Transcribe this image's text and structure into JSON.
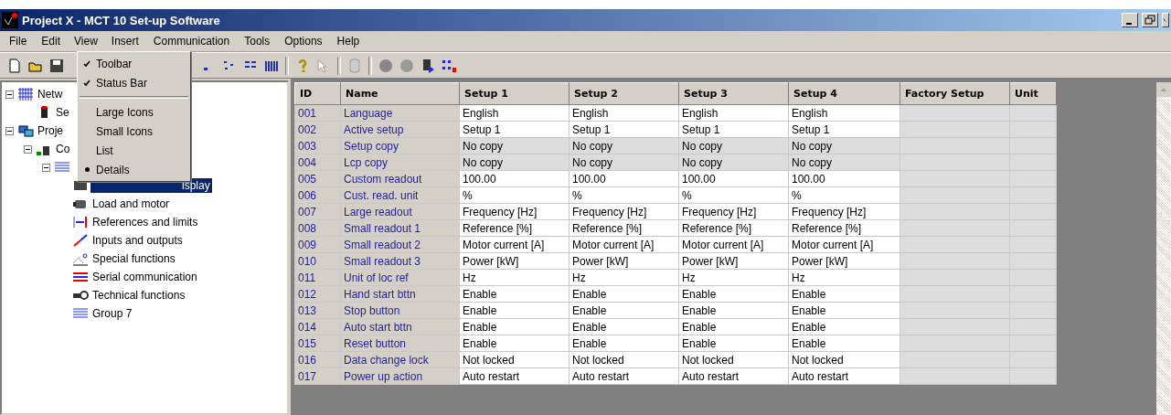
{
  "window": {
    "title": "Project X - MCT 10 Set-up Software"
  },
  "menu_bar": [
    {
      "label": "File",
      "selected": false
    },
    {
      "label": "Edit",
      "selected": false
    },
    {
      "label": "View",
      "selected": true
    },
    {
      "label": "Insert",
      "selected": false
    },
    {
      "label": "Communication",
      "selected": false
    },
    {
      "label": "Tools",
      "selected": false
    },
    {
      "label": "Options",
      "selected": false
    },
    {
      "label": "Help",
      "selected": false
    }
  ],
  "view_menu": [
    {
      "kind": "check",
      "label": "Toolbar",
      "checked": true
    },
    {
      "kind": "check",
      "label": "Status Bar",
      "checked": true
    },
    {
      "kind": "separator"
    },
    {
      "kind": "radio",
      "label": "Large Icons",
      "selected": false
    },
    {
      "kind": "radio",
      "label": "Small Icons",
      "selected": false
    },
    {
      "kind": "radio",
      "label": "List",
      "selected": false
    },
    {
      "kind": "radio",
      "label": "Details",
      "selected": true
    }
  ],
  "tree": [
    {
      "label": "Netw",
      "selected": false,
      "expanded": true,
      "children": [
        {
          "label": "Se",
          "selected": false
        }
      ]
    },
    {
      "label": "Proje",
      "selected": false,
      "expanded": true,
      "children": [
        {
          "label": "Co",
          "selected": false,
          "expanded": true,
          "children": [
            {
              "expanded": true,
              "children": [
                {
                  "label": "isplay",
                  "selected": true
                },
                {
                  "label": "Load and motor",
                  "selected": false
                },
                {
                  "label": "References and limits",
                  "selected": false
                },
                {
                  "label": "Inputs and outputs",
                  "selected": false
                },
                {
                  "label": "Special functions",
                  "selected": false
                },
                {
                  "label": "Serial communication",
                  "selected": false
                },
                {
                  "label": "Technical functions",
                  "selected": false
                },
                {
                  "label": "Group 7",
                  "selected": false
                }
              ]
            }
          ]
        }
      ]
    }
  ],
  "table": {
    "columns": [
      "ID",
      "Name",
      "Setup 1",
      "Setup 2",
      "Setup 3",
      "Setup 4",
      "Factory Setup",
      "Unit"
    ],
    "rows": [
      {
        "id": "001",
        "name": "Language",
        "values": [
          "English",
          "English",
          "English",
          "English"
        ],
        "disabled": false
      },
      {
        "id": "002",
        "name": "Active setup",
        "values": [
          "Setup 1",
          "Setup 1",
          "Setup 1",
          "Setup 1"
        ],
        "disabled": false
      },
      {
        "id": "003",
        "name": "Setup copy",
        "values": [
          "No copy",
          "No copy",
          "No copy",
          "No copy"
        ],
        "disabled": true
      },
      {
        "id": "004",
        "name": "Lcp copy",
        "values": [
          "No copy",
          "No copy",
          "No copy",
          "No copy"
        ],
        "disabled": true
      },
      {
        "id": "005",
        "name": "Custom readout",
        "values": [
          "100.00",
          "100.00",
          "100.00",
          "100.00"
        ],
        "disabled": false
      },
      {
        "id": "006",
        "name": "Cust. read. unit",
        "values": [
          "%",
          "%",
          "%",
          "%"
        ],
        "disabled": false
      },
      {
        "id": "007",
        "name": "Large readout",
        "values": [
          "Frequency [Hz]",
          "Frequency [Hz]",
          "Frequency [Hz]",
          "Frequency [Hz]"
        ],
        "disabled": false
      },
      {
        "id": "008",
        "name": "Small readout 1",
        "values": [
          "Reference [%]",
          "Reference [%]",
          "Reference [%]",
          "Reference [%]"
        ],
        "disabled": false
      },
      {
        "id": "009",
        "name": "Small readout 2",
        "values": [
          "Motor current [A]",
          "Motor current [A]",
          "Motor current [A]",
          "Motor current [A]"
        ],
        "disabled": false
      },
      {
        "id": "010",
        "name": "Small readout 3",
        "values": [
          "Power [kW]",
          "Power [kW]",
          "Power [kW]",
          "Power [kW]"
        ],
        "disabled": false
      },
      {
        "id": "011",
        "name": "Unit of loc ref",
        "values": [
          "Hz",
          "Hz",
          "Hz",
          "Hz"
        ],
        "disabled": false
      },
      {
        "id": "012",
        "name": "Hand start bttn",
        "values": [
          "Enable",
          "Enable",
          "Enable",
          "Enable"
        ],
        "disabled": false
      },
      {
        "id": "013",
        "name": "Stop button",
        "values": [
          "Enable",
          "Enable",
          "Enable",
          "Enable"
        ],
        "disabled": false
      },
      {
        "id": "014",
        "name": "Auto start bttn",
        "values": [
          "Enable",
          "Enable",
          "Enable",
          "Enable"
        ],
        "disabled": false
      },
      {
        "id": "015",
        "name": "Reset button",
        "values": [
          "Enable",
          "Enable",
          "Enable",
          "Enable"
        ],
        "disabled": false
      },
      {
        "id": "016",
        "name": "Data change lock",
        "values": [
          "Not locked",
          "Not locked",
          "Not locked",
          "Not locked"
        ],
        "disabled": false
      },
      {
        "id": "017",
        "name": "Power up action",
        "values": [
          "Auto restart",
          "Auto restart",
          "Auto restart",
          "Auto restart"
        ],
        "disabled": false
      }
    ]
  }
}
